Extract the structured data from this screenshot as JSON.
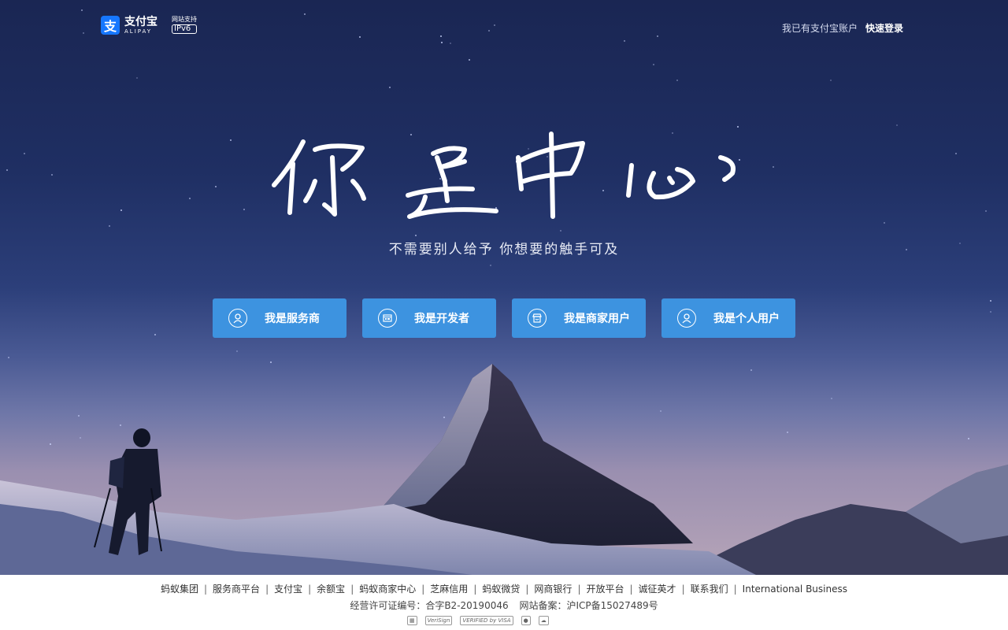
{
  "header": {
    "logo_cn": "支付宝",
    "logo_en": "ALIPAY",
    "logo_mark": "支",
    "ipv6_caption": "网站支持",
    "ipv6_badge": "IPv6",
    "has_account": "我已有支付宝账户",
    "quick_login": "快速登录"
  },
  "hero": {
    "headline": "你是中心",
    "subtitle": "不需要别人给予  你想要的触手可及",
    "roles": [
      {
        "label": "我是服务商",
        "icon": "user-icon"
      },
      {
        "label": "我是开发者",
        "icon": "code-window-icon"
      },
      {
        "label": "我是商家用户",
        "icon": "store-icon"
      },
      {
        "label": "我是个人用户",
        "icon": "user-icon"
      }
    ]
  },
  "footer": {
    "links": [
      "蚂蚁集团",
      "服务商平台",
      "支付宝",
      "余额宝",
      "蚂蚁商家中心",
      "芝麻信用",
      "蚂蚁微贷",
      "网商银行",
      "开放平台",
      "诚征英才",
      "联系我们",
      "International Business"
    ],
    "license": "经营许可证编号：合字B2-20190046",
    "icp": "网站备案：沪ICP备15027489号",
    "trust_badges": [
      "VeriSign",
      "VERIFIED by VISA"
    ]
  },
  "colors": {
    "accent": "#3d93e0",
    "brand": "#1677ff",
    "sky_top": "#1a2653"
  }
}
